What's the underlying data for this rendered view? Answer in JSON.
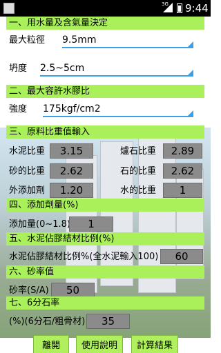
{
  "status": {
    "time": "9:44",
    "signal": "3G"
  },
  "s1": {
    "title": "一、用水量及含氣量決定",
    "aggregate": {
      "label": "最大粒徑",
      "value": "9.5mm"
    },
    "slump": {
      "label": "坍度",
      "value": "2.5~5cm"
    }
  },
  "s2": {
    "title": "二、最大容許水膠比",
    "strength": {
      "label": "強度",
      "value": "175kgf/cm2"
    }
  },
  "s3": {
    "title": "三、原料比重值輸入",
    "cement": {
      "label": "水泥比重",
      "value": "3.15"
    },
    "slag": {
      "label": "爐石比重",
      "value": "2.89"
    },
    "sand": {
      "label": "砂的比重",
      "value": "2.62"
    },
    "stone": {
      "label": "石的比重",
      "value": "2.62"
    },
    "admixture": {
      "label": "外添加劑",
      "value": "1.20"
    },
    "water": {
      "label": "水的比重",
      "value": "1"
    }
  },
  "s4": {
    "title": "四、添加劑量(%)",
    "dosage": {
      "label": "添加量(0~1.8)",
      "value": "1"
    }
  },
  "s5": {
    "title": "五、水泥佔膠結材比例(%)",
    "ratio": {
      "label": "水泥佔膠結材比例%(全水泥輸入100)",
      "value": "60"
    }
  },
  "s6": {
    "title": "六、砂率值",
    "sandratio": {
      "label": "砂率(S/A)",
      "value": "50"
    }
  },
  "s7": {
    "title": "七、6分石率",
    "gravel": {
      "label": "(%)(6分石/粗骨材)",
      "value": "35"
    }
  },
  "buttons": {
    "exit": "離開",
    "help": "使用說明",
    "calc": "計算結果"
  },
  "colors": {
    "section_header": "#aaf05a",
    "accent": "#3aa0e8",
    "input_box": "#8b8b8b"
  }
}
